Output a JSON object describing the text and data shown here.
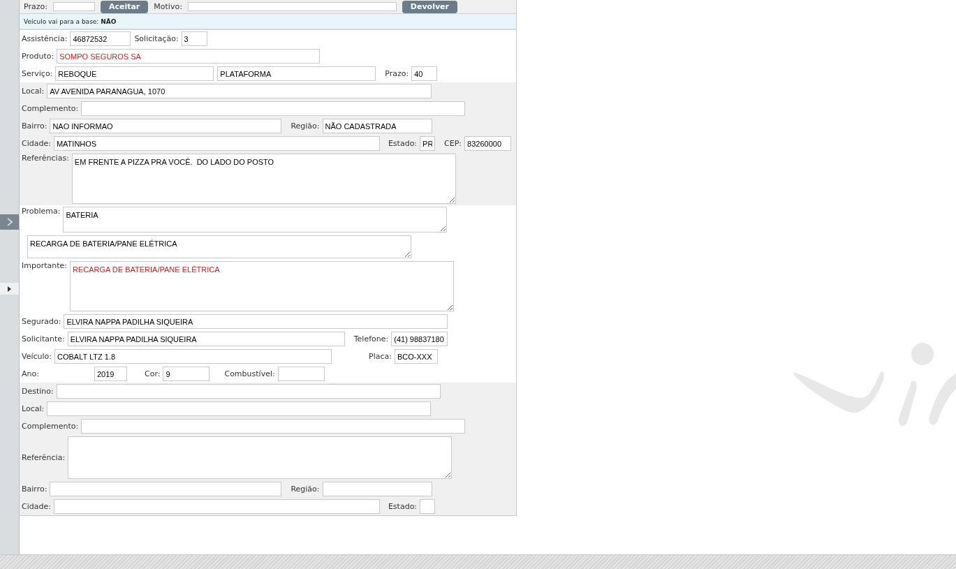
{
  "top_bar": [
    {
      "kind": "field",
      "label": "Prazo:"
    },
    {
      "kind": "button",
      "label": "Aceitar"
    },
    {
      "kind": "field",
      "label": "Motivo:"
    },
    {
      "kind": "button",
      "label": "Devolver"
    }
  ],
  "info": {
    "label": "Veículo vai para a base:",
    "value": "NÃO"
  },
  "sections": [
    {
      "shaded": false,
      "lines": [
        {
          "fields": [
            {
              "kind": "input",
              "label": "Assistência:",
              "value": "46872532"
            },
            {
              "kind": "input",
              "label": "Solicitação:",
              "value": "3"
            }
          ]
        },
        {
          "fields": [
            {
              "kind": "input",
              "label": "Produto:",
              "value": "SOMPO SEGUROS SA",
              "alert": true
            }
          ]
        },
        {
          "fields": [
            {
              "kind": "input",
              "label": "Serviço:",
              "value": "REBOQUE"
            },
            {
              "kind": "input",
              "value": "PLATAFORMA"
            },
            {
              "kind": "input",
              "label": "Prazo:",
              "value": "40"
            }
          ]
        }
      ]
    },
    {
      "shaded": true,
      "lines": [
        {
          "fields": [
            {
              "kind": "input",
              "label": "Local:",
              "value": "AV AVENIDA PARANAGUA, 1070"
            }
          ]
        },
        {
          "fields": [
            {
              "kind": "input",
              "label": "Complemento:"
            }
          ]
        },
        {
          "fields": [
            {
              "kind": "input",
              "label": "Bairro:",
              "value": "NAO INFORMAO"
            },
            {
              "kind": "input",
              "label": "Região:",
              "value": "NÃO CADASTRADA"
            }
          ]
        },
        {
          "fields": [
            {
              "kind": "input",
              "label": "Cidade:",
              "value": "MATINHOS"
            },
            {
              "kind": "input",
              "label": "Estado:",
              "value": "PR"
            },
            {
              "kind": "input",
              "label": "CEP:",
              "value": "83260000"
            }
          ]
        },
        {
          "fields": [
            {
              "kind": "textarea",
              "label": "Referências:",
              "value": "EM FRENTE A PIZZA PRA VOCÊ.  DO LADO DO POSTO"
            }
          ]
        }
      ]
    },
    {
      "shaded": false,
      "lines": [
        {
          "fields": [
            {
              "kind": "textarea",
              "label": "Problema:",
              "value": "BATERIA"
            }
          ]
        },
        {
          "fields": [
            {
              "kind": "textarea",
              "value": "RECARGA DE BATERIA/PANE ELÉTRICA"
            }
          ]
        },
        {
          "fields": [
            {
              "kind": "textarea",
              "label": "Importante:",
              "value": "RECARGA DE BATERIA/PANE ELÉTRICA",
              "alert": true
            }
          ]
        },
        {
          "fields": [
            {
              "kind": "input",
              "label": "Segurado:",
              "value": "ELVIRA NAPPA PADILHA SIQUEIRA"
            }
          ]
        },
        {
          "fields": [
            {
              "kind": "input",
              "label": "Solicitante:",
              "value": "ELVIRA NAPPA PADILHA SIQUEIRA"
            },
            {
              "kind": "input",
              "label": "Telefone:",
              "value": "(41) 98837180"
            }
          ]
        },
        {
          "fields": [
            {
              "kind": "input",
              "label": "Veículo:",
              "value": "COBALT LTZ 1.8"
            },
            {
              "kind": "input",
              "label": "Placa:",
              "value": "BCO-XXX"
            }
          ]
        },
        {
          "fields": [
            {
              "kind": "input",
              "label": "Ano:",
              "value": "2019"
            },
            {
              "kind": "input",
              "label": "Cor:",
              "value": "9"
            },
            {
              "kind": "input",
              "label": "Combustível:"
            }
          ]
        }
      ]
    },
    {
      "shaded": true,
      "lines": [
        {
          "fields": [
            {
              "kind": "input",
              "label": "Destino:"
            }
          ]
        },
        {
          "fields": [
            {
              "kind": "input",
              "label": "Local:"
            }
          ]
        },
        {
          "fields": [
            {
              "kind": "input",
              "label": "Complemento:"
            }
          ]
        },
        {
          "fields": [
            {
              "kind": "textarea",
              "label": "Referência:"
            }
          ]
        },
        {
          "fields": [
            {
              "kind": "input",
              "label": "Bairro:"
            },
            {
              "kind": "input",
              "label": "Região:"
            }
          ]
        },
        {
          "fields": [
            {
              "kind": "input",
              "label": "Cidade:"
            },
            {
              "kind": "input",
              "label": "Estado:"
            }
          ]
        }
      ]
    }
  ]
}
